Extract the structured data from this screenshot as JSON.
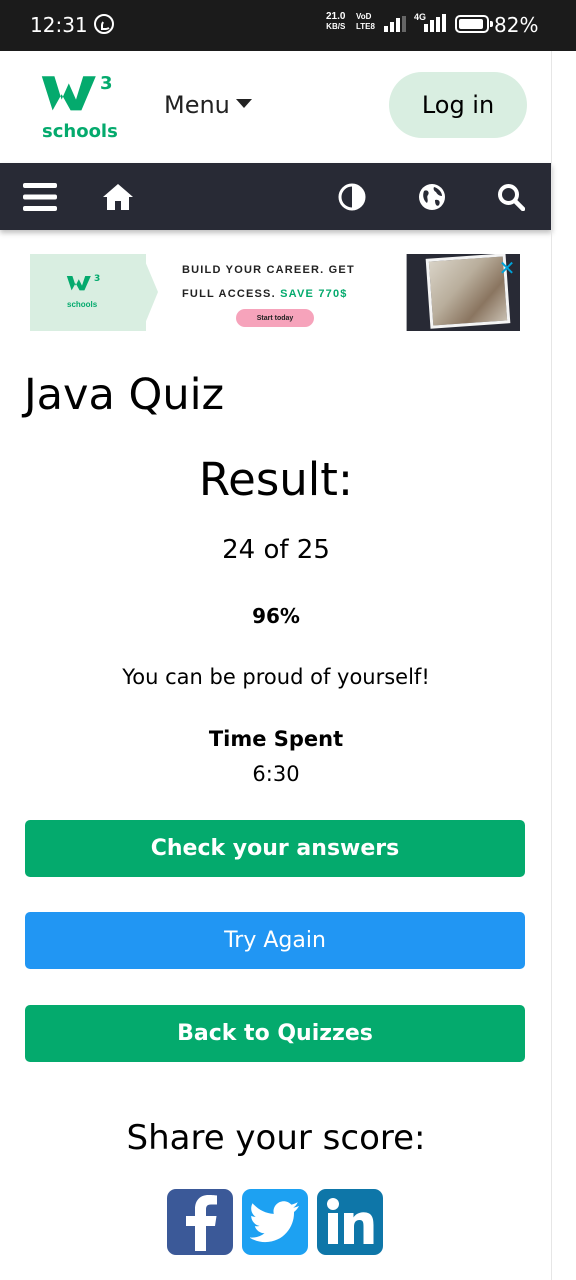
{
  "status_bar": {
    "time": "12:31",
    "net_speed_value": "21.0",
    "net_speed_unit": "KB/S",
    "volte_top": "VoD",
    "volte_bottom": "LTE8",
    "network_type": "4G",
    "battery_percent": "82%",
    "battery_level": 0.82
  },
  "header": {
    "logo_superscript": "3",
    "logo_text": "schools",
    "menu_label": "Menu",
    "login_label": "Log in",
    "brand_color": "#04aa6d"
  },
  "navbar": {
    "background": "#282a35",
    "icons": [
      "hamburger-menu-icon",
      "home-icon",
      "contrast-icon",
      "globe-icon",
      "search-icon"
    ]
  },
  "ad": {
    "logo_superscript": "3",
    "logo_text": "schools",
    "line1": "BUILD YOUR CAREER. GET",
    "line2_prefix": "FULL ACCESS.",
    "line2_highlight": "SAVE 770$",
    "cta": "Start today",
    "close_icon": "close-icon"
  },
  "quiz": {
    "title": "Java Quiz",
    "result_heading": "Result:",
    "score": "24 of 25",
    "percentage": "96%",
    "message": "You can be proud of yourself!",
    "time_label": "Time Spent",
    "time_value": "6:30"
  },
  "buttons": {
    "check_answers": "Check your answers",
    "try_again": "Try Again",
    "back_to_quizzes": "Back to Quizzes"
  },
  "share": {
    "heading": "Share your score:",
    "networks": [
      "facebook-icon",
      "twitter-icon",
      "linkedin-icon"
    ]
  }
}
